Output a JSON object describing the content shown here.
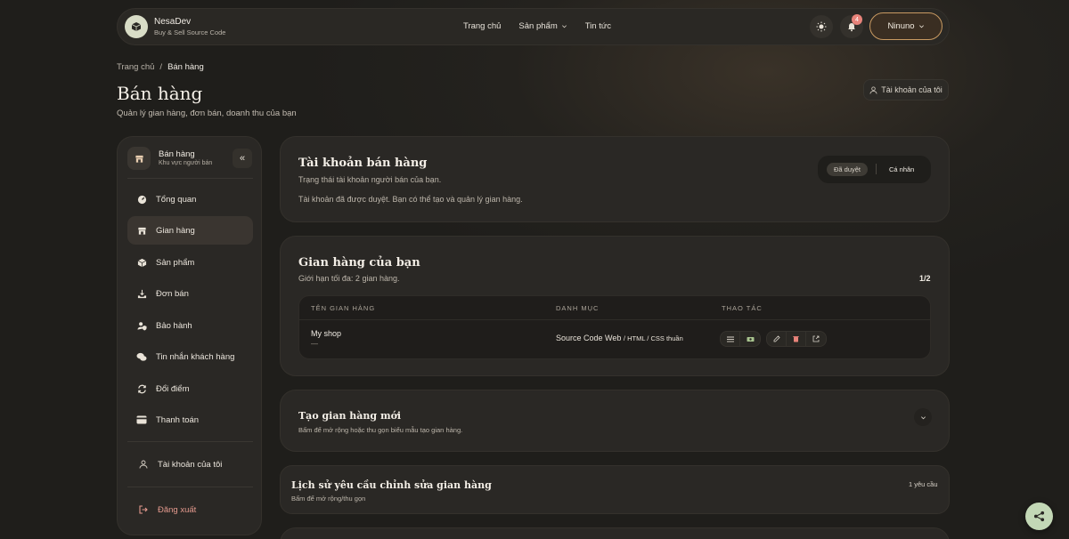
{
  "brand": {
    "name": "NesaDev",
    "tagline": "Buy & Sell Source Code"
  },
  "nav": {
    "home": "Trang chủ",
    "products": "Sản phẩm",
    "news": "Tin tức"
  },
  "header": {
    "notification_count": "4",
    "user_name": "Ninuno"
  },
  "breadcrumb": {
    "home": "Trang chủ",
    "separator": "/",
    "current": "Bán hàng"
  },
  "page": {
    "title": "Bán hàng",
    "subtitle": "Quản lý gian hàng, đơn bán, doanh thu của bạn",
    "account_button": "Tài khoản của tôi"
  },
  "sidebar": {
    "title": "Bán hàng",
    "subtitle": "Khu vực người bán",
    "collapse": "«",
    "items": [
      {
        "label": "Tổng quan",
        "icon": "gauge-icon"
      },
      {
        "label": "Gian hàng",
        "icon": "store-icon"
      },
      {
        "label": "Sản phẩm",
        "icon": "box-icon"
      },
      {
        "label": "Đơn bán",
        "icon": "tray-icon"
      },
      {
        "label": "Bảo hành",
        "icon": "user-shield-icon"
      },
      {
        "label": "Tin nhắn khách hàng",
        "icon": "chat-icon"
      },
      {
        "label": "Đổi điểm",
        "icon": "exchange-icon"
      },
      {
        "label": "Thanh toán",
        "icon": "card-icon"
      }
    ],
    "account": "Tài khoản của tôi",
    "logout": "Đăng xuất"
  },
  "seller_account": {
    "title": "Tài khoản bán hàng",
    "subtitle": "Trạng thái tài khoản người bán của bạn.",
    "message": "Tài khoản đã được duyệt. Bạn có thể tạo và quản lý gian hàng.",
    "status": "Đã duyệt",
    "type": "Cá nhân"
  },
  "shops": {
    "title": "Gian hàng của bạn",
    "limit_text": "Giới hạn tối đa: 2 gian hàng.",
    "count": "1/2",
    "columns": [
      "TÊN GIAN HÀNG",
      "DANH MỤC",
      "THAO TÁC"
    ],
    "rows": [
      {
        "name": "My shop",
        "sub": "—",
        "category": "Source Code Web",
        "category_sub": "/ HTML / CSS thuần"
      }
    ]
  },
  "create_shop": {
    "title": "Tạo gian hàng mới",
    "subtitle": "Bấm để mở rộng hoặc thu gọn biểu mẫu tạo gian hàng."
  },
  "edit_history": {
    "title": "Lịch sử yêu cầu chỉnh sửa gian hàng",
    "subtitle": "Bấm để mở rộng/thu gọn",
    "count": "1 yêu cầu"
  },
  "colors": {
    "accent": "#c99a62",
    "background": "#1f1e1b",
    "card": "#2a2825",
    "danger": "#e8837a",
    "share": "#c3d8b6"
  }
}
